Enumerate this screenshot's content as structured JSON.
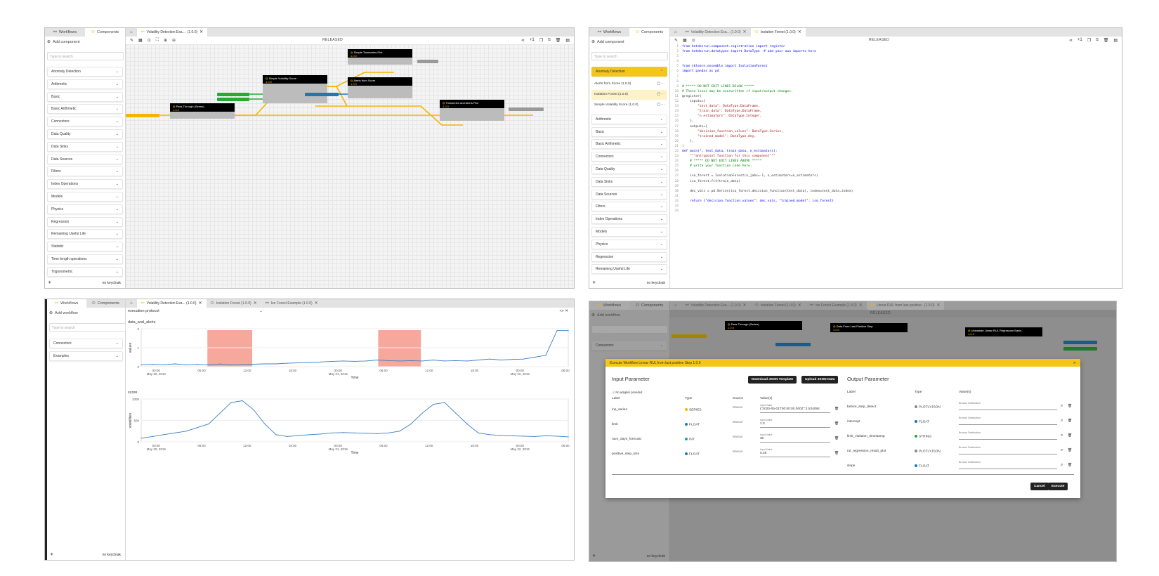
{
  "tabs": {
    "workflows": "Workflows",
    "components": "Components"
  },
  "sidebar": {
    "add_component": "Add component",
    "add_workflow": "Add workflow",
    "search_placeholder": "Type to search",
    "categories": [
      "Anomaly Detection",
      "Arithmetic",
      "Basic",
      "Basic Arithmetic",
      "Connectors",
      "Data Quality",
      "Data Sinks",
      "Data Sources",
      "Filters",
      "Index Operations",
      "Models",
      "Physics",
      "Regression",
      "Remaining Useful Life",
      "Statistic",
      "Time length operations",
      "Trigonometric"
    ],
    "anomaly_items": [
      "Alerts from Score (1.0.0)",
      "Isolation Forest (1.0.0)",
      "Simple Volatility Score (1.0.0)"
    ],
    "p2_categories": [
      "Arithmetic",
      "Basic",
      "Basic Arithmetic",
      "Connectors",
      "Data Quality",
      "Data Sinks",
      "Data Sources",
      "Filters",
      "Index Operations",
      "Models",
      "Physics",
      "Regression",
      "Remaining Useful Life"
    ],
    "wf_categories": [
      "Connectors",
      "Examples"
    ],
    "footer": "no keycloak"
  },
  "status": "RELEASED",
  "doc_tabs": {
    "volatility": "Volatility Detection Exa...",
    "volatility_full": "Volatility Detection Exa...  (1.0.0)",
    "isoforest": "Isolation Forest (1.0.0)",
    "isoexample": "Iso Forest Example (1.0.0)",
    "linear_rul": "Linear RUL from last positive..  (1.0.0)",
    "version": "(1.0.0)"
  },
  "p1_nodes": {
    "pass": "Pass Through (Series)",
    "volscore": "Simple Volatility Score",
    "alerts": "Alerts from Score",
    "simple_ts": "Simple Timeseries Plot",
    "ts_alerts": "Timeseries and Alerts Plot",
    "ver": "1.0.0"
  },
  "code_lines": [
    "from hetdesrun.component.registration import register",
    "from hetdesrun.datatypes import DataType  # add your own imports here",
    "",
    "",
    "from sklearn.ensemble import IsolationForest",
    "import pandas as pd",
    "",
    "",
    "# ***** DO NOT EDIT LINES BELOW *****",
    "# These lines may be overwritten if input/output changes.",
    "@register(",
    "    inputs={",
    "        \"test_data\": DataType.DataFrame,",
    "        \"train_data\": DataType.DataFrame,",
    "        \"n_estimators\": DataType.Integer,",
    "    },",
    "    outputs={",
    "        \"decision_function_values\": DataType.Series,",
    "        \"trained_model\": DataType.Any,",
    "    },",
    ")",
    "def main(*, test_data, train_data, n_estimators):",
    "    \"\"\"entrypoint function for this component\"\"\"",
    "    # ***** DO NOT EDIT LINES ABOVE *****",
    "    # write your function code here.",
    "",
    "    iso_forest = IsolationForest(n_jobs=-1, n_estimators=n_estimators)",
    "    iso_forest.fit(train_data)",
    "",
    "    dec_vals = pd.Series(iso_forest.decision_function(test_data), index=test_data.index)",
    "",
    "    return {\"decision_function_values\": dec_vals, \"trained_model\": iso_forest}",
    "",
    ""
  ],
  "chart": {
    "protocol": "execution protocol",
    "top_title": "data_and_alerts",
    "top_ylabel": "values",
    "bottom_title": "score",
    "bottom_ylabel": "volatilities",
    "xlabel": "Time",
    "xticks": [
      "00:00",
      "06:00",
      "12:00",
      "18:00",
      "00:00",
      "06:00",
      "12:00",
      "18:00",
      "00:00",
      "06:00"
    ],
    "dates": [
      "May 20, 2016",
      "May 21, 2016",
      "May 22, 2016"
    ],
    "top_yticks": [
      "2",
      "1",
      "0"
    ],
    "bottom_yticks": [
      "1000",
      "500",
      "0"
    ]
  },
  "chart_data": [
    {
      "type": "line",
      "title": "data_and_alerts",
      "xlabel": "Time",
      "ylabel": "values",
      "ylim": [
        0,
        2
      ],
      "series": [
        {
          "values": [
            0.1,
            0.12,
            0.1,
            0.15,
            0.1,
            0.12,
            0.1,
            0.14,
            0.1,
            0.12,
            0.13,
            0.15,
            0.15,
            0.18,
            0.2,
            0.22,
            0.25,
            0.28,
            0.3,
            0.28,
            0.3,
            0.35,
            0.32,
            0.3,
            0.32,
            0.3,
            0.35,
            0.3,
            0.32,
            0.3,
            0.35,
            0.4,
            0.35,
            0.38,
            0.4,
            0.5,
            0.6,
            1.9,
            1.9
          ]
        }
      ]
    },
    {
      "type": "line",
      "title": "score",
      "xlabel": "Time",
      "ylabel": "volatilities",
      "ylim": [
        0,
        1200
      ],
      "series": [
        {
          "values": [
            100,
            150,
            200,
            250,
            300,
            400,
            500,
            800,
            1100,
            1150,
            900,
            500,
            200,
            150,
            180,
            200,
            220,
            250,
            260,
            250,
            240,
            230,
            250,
            300,
            500,
            800,
            1050,
            1100,
            800,
            500,
            250,
            200,
            180,
            170,
            160,
            150,
            170,
            160,
            140
          ]
        }
      ]
    }
  ],
  "modal": {
    "title": "Execute Workflow Linear RUL from last positive Step 1.0.0",
    "input_title": "Input Parameter",
    "output_title": "Output Parameter",
    "download": "Download JSON Template",
    "upload": "Upload JSON Data",
    "no_adapter": "No adapter provided",
    "cols": {
      "label": "Label",
      "type": "Type",
      "source": "Source",
      "value": "Value(s)"
    },
    "inputs": [
      {
        "label": "inp_series",
        "type": "SERIES",
        "color": "#f5b400",
        "source": "Manual",
        "value": "{\"2020-05-01T00:00:00.000Z\":2.534094"
      },
      {
        "label": "limit",
        "type": "FLOAT",
        "color": "#1f77b4",
        "source": "Manual",
        "value": "1.3"
      },
      {
        "label": "num_days_forecast",
        "type": "INT",
        "color": "#17a2b8",
        "source": "Manual",
        "value": "30"
      },
      {
        "label": "positive_step_size",
        "type": "FLOAT",
        "color": "#1f77b4",
        "source": "Manual",
        "value": "0.25"
      }
    ],
    "input_value_label": "Input Value",
    "outputs": [
      {
        "label": "before_step_detect",
        "type": "PLOTLYJSON",
        "color": "#888"
      },
      {
        "label": "intercept",
        "type": "FLOAT",
        "color": "#1f77b4"
      },
      {
        "label": "limit_violation_timestamp",
        "type": "STRING",
        "color": "#28a745"
      },
      {
        "label": "rul_regression_result_plot",
        "type": "PLOTLYJSON",
        "color": "#888"
      },
      {
        "label": "slope",
        "type": "FLOAT",
        "color": "#1f77b4"
      }
    ],
    "browse": "Browse Destination",
    "cancel": "Cancel",
    "execute": "Execute"
  },
  "p4_nodes": {
    "pass": "Pass Through (Series)",
    "last_step": "Data From Last Positive Step",
    "univariate": "Univariate Linear RUL Regression Basic...",
    "ver": "1.0.0"
  }
}
